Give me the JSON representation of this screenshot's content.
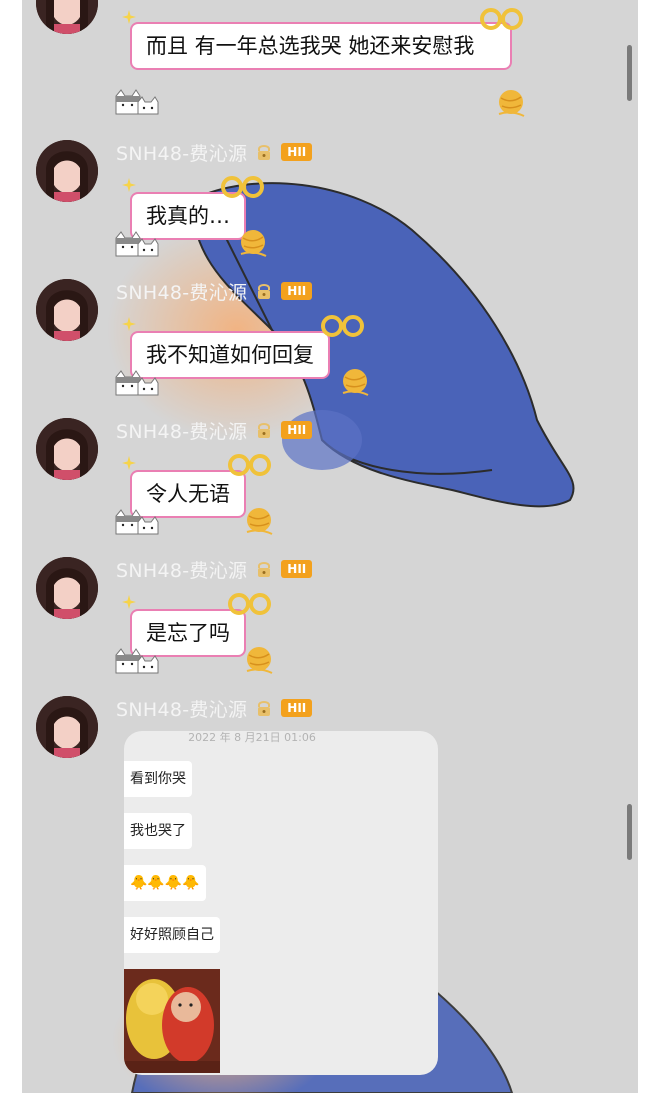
{
  "sender": {
    "name": "SNH48-费沁源",
    "badge": "HII"
  },
  "messages": [
    {
      "text": "而且 有一年总选我哭 她还来安慰我"
    },
    {
      "text": "我真的…"
    },
    {
      "text": "我不知道如何回复"
    },
    {
      "text": "令人无语"
    },
    {
      "text": "是忘了吗"
    }
  ],
  "quote": {
    "date": "2022 年 8 月21日 01:06",
    "messages": [
      {
        "text": "看到你哭"
      },
      {
        "text": "我也哭了"
      },
      {
        "text": "🐥🐥🐥🐥"
      },
      {
        "text": "好好照顾自己"
      }
    ]
  },
  "colors": {
    "chat_bg": "#d5d5d5",
    "bubble_border": "#ea7fb3",
    "badge": "#f3a11d",
    "sender_name": "#f4f4f4"
  }
}
